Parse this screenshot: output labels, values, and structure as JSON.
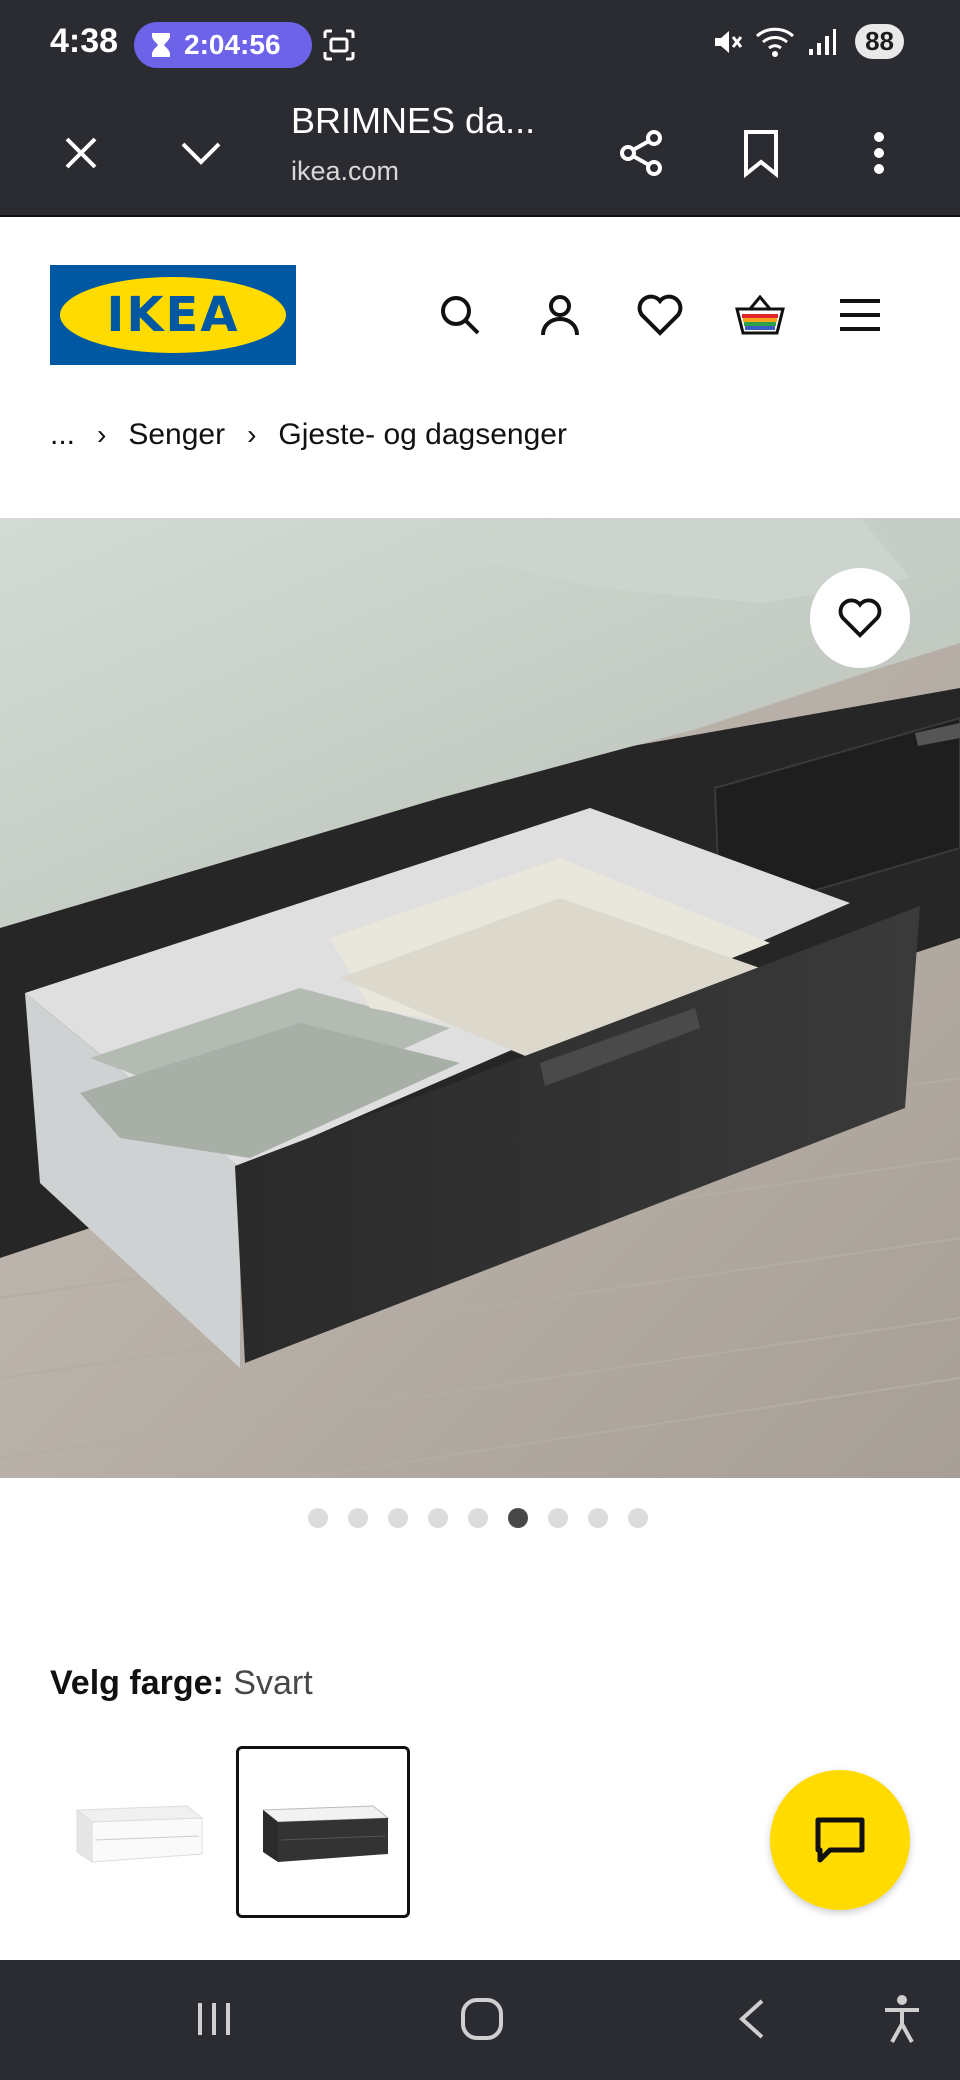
{
  "status_bar": {
    "time": "4:38",
    "timer": "2:04:56",
    "battery": "88"
  },
  "browser": {
    "page_title": "BRIMNES da...",
    "url": "ikea.com"
  },
  "header": {
    "logo_text": "IKEA"
  },
  "breadcrumb": {
    "ellipsis": "...",
    "items": [
      "Senger",
      "Gjeste- og dagsenger"
    ]
  },
  "gallery": {
    "dot_count": 9,
    "active_index": 5
  },
  "color_selector": {
    "label": "Velg farge:",
    "selected_value": "Svart",
    "options": [
      "white",
      "black"
    ]
  },
  "colors": {
    "chrome": "#2b2c31",
    "ikea_blue": "#0058a3",
    "ikea_yellow": "#ffdb00",
    "timer_pill": "#6c63e8"
  }
}
